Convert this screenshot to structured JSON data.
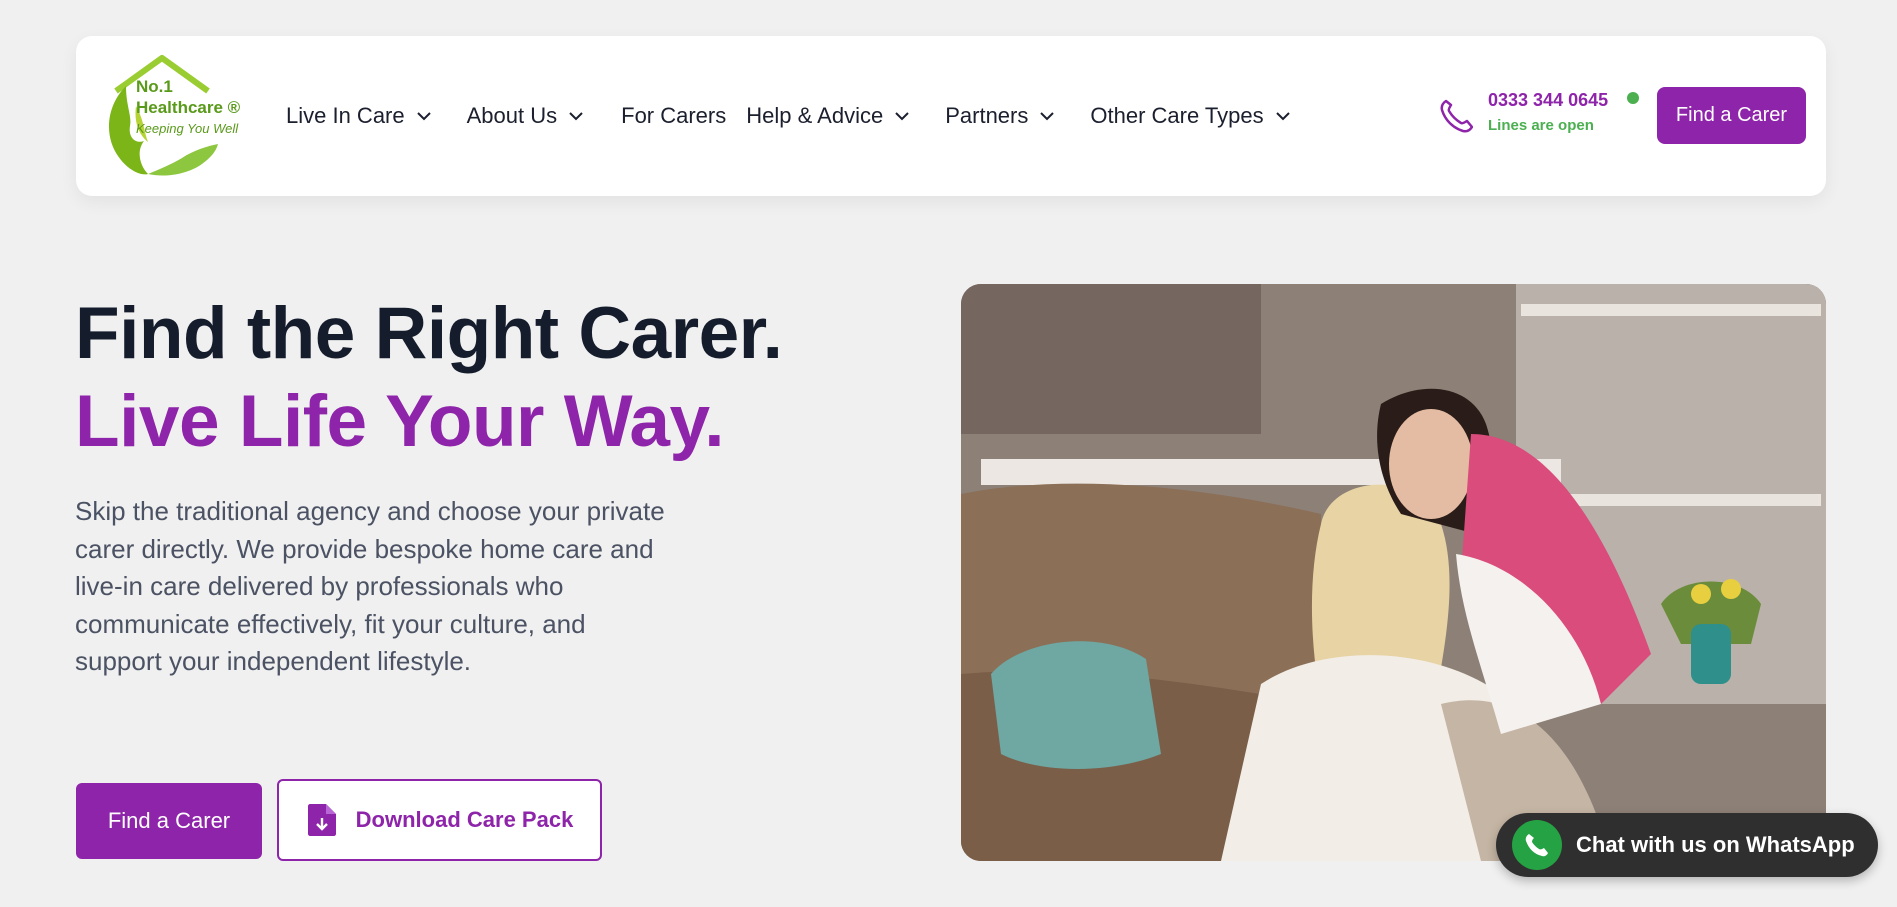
{
  "brand": {
    "line1": "No.1",
    "line2": "Healthcare ®",
    "tagline": "Keeping You Well"
  },
  "nav": {
    "items": [
      {
        "label": "Live In Care",
        "dropdown": true
      },
      {
        "label": "About Us",
        "dropdown": true
      },
      {
        "label": "For Carers",
        "dropdown": false
      },
      {
        "label": "Help & Advice",
        "dropdown": true
      },
      {
        "label": "Partners",
        "dropdown": true
      },
      {
        "label": "Other Care Types",
        "dropdown": true
      }
    ]
  },
  "contact": {
    "phone": "0333 344 0645",
    "status": "Lines are open"
  },
  "header": {
    "cta_label": "Find a Carer"
  },
  "hero": {
    "title_line1": "Find the Right Carer.",
    "title_line2": "Live Life Your Way.",
    "description": "Skip the traditional agency and choose your private carer directly. We provide bespoke home care and live-in care delivered by professionals who communicate effectively, fit your culture, and support your independent lifestyle.",
    "primary_cta": "Find a Carer",
    "secondary_cta": "Download Care Pack"
  },
  "whatsapp": {
    "label": "Chat with us on WhatsApp"
  },
  "colors": {
    "brand_purple": "#8e24aa",
    "brand_green": "#7cb518",
    "status_green": "#4caf50",
    "whatsapp_green": "#25a244"
  }
}
